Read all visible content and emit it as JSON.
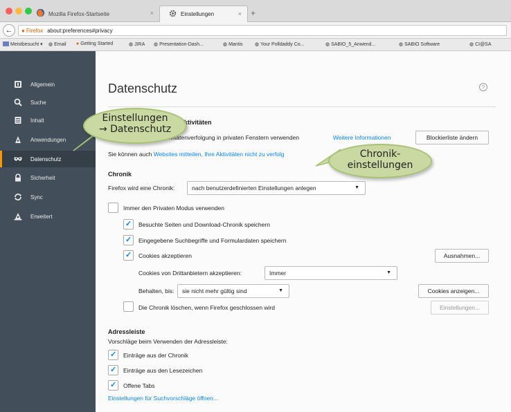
{
  "browser": {
    "tabs": [
      {
        "title": "Mozilla Firefox-Startseite",
        "close": "×"
      },
      {
        "title": "Einstellungen",
        "close": "×"
      }
    ],
    "new_tab": "+",
    "url_label": "Firefox",
    "url": "about:preferences#privacy",
    "back": "←"
  },
  "bookmarks": [
    "Meistbesucht ▾",
    "Email",
    "Getting Started",
    "JIRA",
    "Presentation-Dash...",
    "Mantis",
    "Your Polldaddy Co...",
    "SABIO_5_Anwend...",
    "SABIO Software",
    "CI@SA"
  ],
  "sidebar": {
    "items": [
      {
        "label": "Allgemein",
        "icon": "general-icon"
      },
      {
        "label": "Suche",
        "icon": "search-icon"
      },
      {
        "label": "Inhalt",
        "icon": "content-icon"
      },
      {
        "label": "Anwendungen",
        "icon": "applications-icon"
      },
      {
        "label": "Datenschutz",
        "icon": "privacy-mask-icon",
        "selected": true
      },
      {
        "label": "Sicherheit",
        "icon": "lock-icon"
      },
      {
        "label": "Sync",
        "icon": "sync-icon"
      },
      {
        "label": "Erweitert",
        "icon": "advanced-icon"
      }
    ],
    "accent": "#ff9500"
  },
  "main": {
    "title": "Datenschutz",
    "help": "?",
    "tracking": {
      "heading_fragment": "ktivitäten",
      "line1": "ivitätenverfolgung in privaten Fenstern verwenden",
      "more_info_link": "Weitere Informationen",
      "blocklist_button": "Blockierliste ändern",
      "line2_prefix": "Sie können auch ",
      "line2_link": "Websites mitteilen, Ihre Aktivitäten nicht zu verfolg"
    },
    "history": {
      "heading": "Chronik",
      "will_label": "Firefox wird eine Chronik:",
      "will_value": "nach benutzerdefinierten Einstellungen anlegen",
      "private_mode": "Immer den Privaten Modus verwenden",
      "visited": "Besuchte Seiten und Download-Chronik speichern",
      "search_form": "Eingegebene Suchbegriffe und Formulardaten speichern",
      "accept_cookies": "Cookies akzeptieren",
      "exceptions_button": "Ausnahmen...",
      "third_party_label": "Cookies von Drittanbietern akzeptieren:",
      "third_party_value": "Immer",
      "keep_until_label": "Behalten, bis:",
      "keep_until_value": "sie nicht mehr gültig sind",
      "show_cookies_button": "Cookies anzeigen...",
      "clear_on_close": "Die Chronik löschen, wenn Firefox geschlossen wird",
      "settings_button": "Einstellungen..."
    },
    "addressbar": {
      "heading": "Adressleiste",
      "subtext": "Vorschläge beim Verwenden der Adressleiste:",
      "history": "Einträge aus der Chronik",
      "bookmarks": "Einträge aus den Lesezeichen",
      "open_tabs": "Offene Tabs",
      "suggestions_link": "Einstellungen für Suchvorschläge öffnen..."
    }
  },
  "callouts": {
    "c1_line1": "Einstellungen",
    "c1_line2": "→ Datenschutz",
    "c2_line1": "Chronik-",
    "c2_line2": "einstellungen"
  },
  "colors": {
    "sidebar_bg": "#424f5a",
    "link": "#0a84ff",
    "callout_fill": "#c9d9a1"
  }
}
